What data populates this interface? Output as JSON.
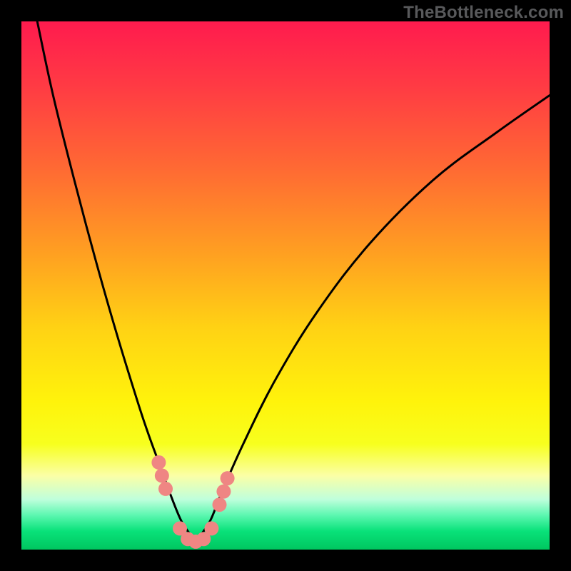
{
  "attribution": "TheBottleneck.com",
  "colors": {
    "frame": "#000000",
    "attribution_text": "#58595b",
    "curve_stroke": "#000000",
    "marker_fill": "#ef8683",
    "gradient_stops": [
      {
        "offset": 0.0,
        "color": "#ff1b4e"
      },
      {
        "offset": 0.12,
        "color": "#ff3a44"
      },
      {
        "offset": 0.28,
        "color": "#ff6a33"
      },
      {
        "offset": 0.44,
        "color": "#ffa021"
      },
      {
        "offset": 0.58,
        "color": "#ffd214"
      },
      {
        "offset": 0.72,
        "color": "#fff30b"
      },
      {
        "offset": 0.8,
        "color": "#f7ff1e"
      },
      {
        "offset": 0.86,
        "color": "#fbffa6"
      },
      {
        "offset": 0.905,
        "color": "#bfffdc"
      },
      {
        "offset": 0.935,
        "color": "#5cf7b0"
      },
      {
        "offset": 0.965,
        "color": "#09e27a"
      },
      {
        "offset": 1.0,
        "color": "#00c65f"
      }
    ]
  },
  "chart_data": {
    "type": "line",
    "title": "",
    "xlabel": "",
    "ylabel": "",
    "xlim": [
      0,
      100
    ],
    "ylim": [
      0,
      100
    ],
    "series": [
      {
        "name": "bottleneck-curve",
        "x": [
          3,
          6,
          10,
          14,
          18,
          22,
          24,
          26,
          28,
          30,
          31.5,
          33,
          34.5,
          36,
          38,
          42,
          48,
          56,
          66,
          78,
          90,
          100
        ],
        "y": [
          100,
          86,
          70,
          55,
          41,
          28,
          22,
          16.5,
          11,
          6,
          3.5,
          2,
          3.5,
          6,
          11,
          20,
          32,
          45,
          58,
          70,
          79,
          86
        ]
      }
    ],
    "markers": {
      "name": "highlight-points",
      "x": [
        26,
        26.6,
        27.3,
        30,
        31.5,
        33,
        34.5,
        36,
        37.5,
        38.3,
        39
      ],
      "y": [
        16.5,
        14,
        11.5,
        4,
        2,
        1.5,
        2,
        4,
        8.5,
        11,
        13.5
      ]
    }
  }
}
